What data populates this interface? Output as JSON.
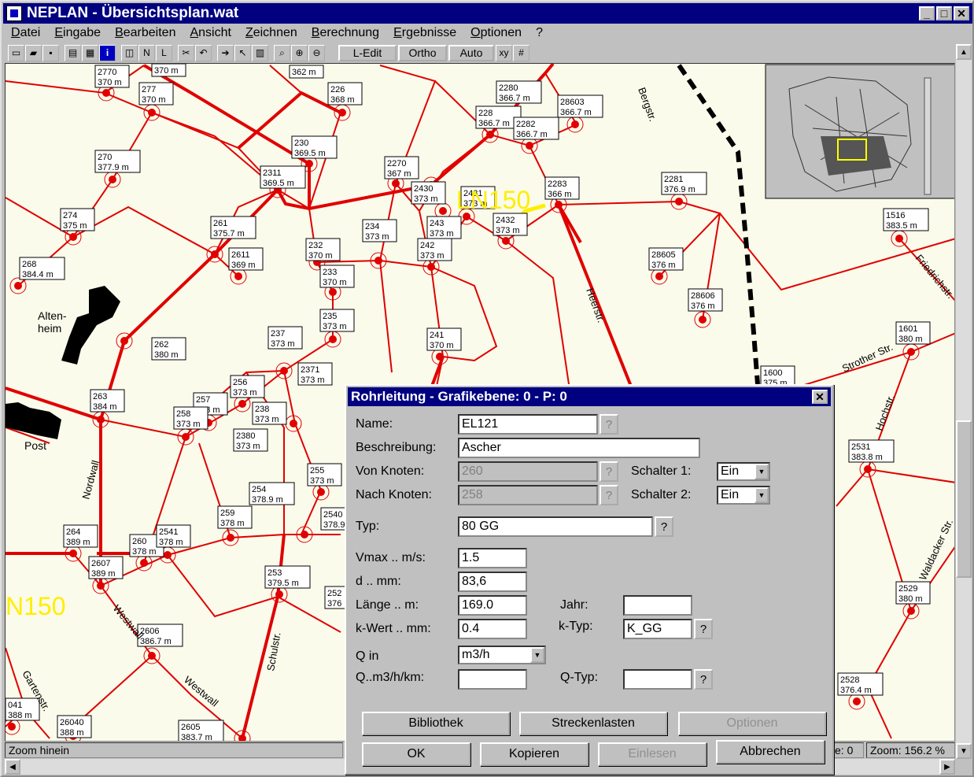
{
  "window": {
    "title": "NEPLAN  -  Übersichtsplan.wat"
  },
  "menu": [
    "Datei",
    "Eingabe",
    "Bearbeiten",
    "Ansicht",
    "Zeichnen",
    "Berechnung",
    "Ergebnisse",
    "Optionen",
    "?"
  ],
  "toolbar": {
    "ledit": "L-Edit",
    "ortho": "Ortho",
    "auto": "Auto",
    "xy": "xy"
  },
  "map": {
    "nodes": [
      {
        "id": "2770",
        "h": "370 m"
      },
      {
        "id": "370 m",
        "h": ""
      },
      {
        "id": "362 m",
        "h": ""
      },
      {
        "id": "226",
        "h": "368 m"
      },
      {
        "id": "277",
        "h": "370 m"
      },
      {
        "id": "2280",
        "h": "366.7 m"
      },
      {
        "id": "28603",
        "h": "366.7 m"
      },
      {
        "id": "228",
        "h": "366.7 m"
      },
      {
        "id": "2282",
        "h": "366.7 m"
      },
      {
        "id": "230",
        "h": "369.5 m"
      },
      {
        "id": "270",
        "h": "377.9 m"
      },
      {
        "id": "2270",
        "h": "367 m"
      },
      {
        "id": "2311",
        "h": "369.5 m"
      },
      {
        "id": "2281",
        "h": "376.9 m"
      },
      {
        "id": "2283",
        "h": "366 m"
      },
      {
        "id": "2430",
        "h": "373 m"
      },
      {
        "id": "2431",
        "h": "373 m"
      },
      {
        "id": "274",
        "h": "375 m"
      },
      {
        "id": "261",
        "h": "375.7 m"
      },
      {
        "id": "234",
        "h": "373 m"
      },
      {
        "id": "243",
        "h": "373 m"
      },
      {
        "id": "2432",
        "h": "373 m"
      },
      {
        "id": "1516",
        "h": "383.5 m"
      },
      {
        "id": "268",
        "h": "384.4 m"
      },
      {
        "id": "2611",
        "h": "369 m"
      },
      {
        "id": "232",
        "h": "370 m"
      },
      {
        "id": "242",
        "h": "373 m"
      },
      {
        "id": "28605",
        "h": "376 m"
      },
      {
        "id": "233",
        "h": "370 m"
      },
      {
        "id": "28606",
        "h": "376 m"
      },
      {
        "id": "235",
        "h": "373 m"
      },
      {
        "id": "262",
        "h": "380 m"
      },
      {
        "id": "237",
        "h": "373 m"
      },
      {
        "id": "241",
        "h": "370 m"
      },
      {
        "id": "1601",
        "h": "380 m"
      },
      {
        "id": "2371",
        "h": "373 m"
      },
      {
        "id": "1600",
        "h": "375 m"
      },
      {
        "id": "256",
        "h": "373 m"
      },
      {
        "id": "263",
        "h": "384 m"
      },
      {
        "id": "257",
        "h": "373 m"
      },
      {
        "id": "238",
        "h": "373 m"
      },
      {
        "id": "258",
        "h": "373 m"
      },
      {
        "id": "2380",
        "h": "373 m"
      },
      {
        "id": "2531",
        "h": "383.8 m"
      },
      {
        "id": "255",
        "h": "373 m"
      },
      {
        "id": "254",
        "h": "378.9 m"
      },
      {
        "id": "259",
        "h": "378 m"
      },
      {
        "id": "2540",
        "h": "378.9"
      },
      {
        "id": "264",
        "h": "389 m"
      },
      {
        "id": "260",
        "h": "378 m"
      },
      {
        "id": "2541",
        "h": "378 m"
      },
      {
        "id": "2607",
        "h": "389 m"
      },
      {
        "id": "253",
        "h": "379.5 m"
      },
      {
        "id": "252",
        "h": "376"
      },
      {
        "id": "2529",
        "h": "380 m"
      },
      {
        "id": "2606",
        "h": "386.7 m"
      },
      {
        "id": "2528",
        "h": "376.4 m"
      },
      {
        "id": "041",
        "h": "388 m"
      },
      {
        "id": "26040",
        "h": "388 m"
      },
      {
        "id": "2605",
        "h": "383.7 m"
      }
    ],
    "streets": [
      "Bergstr.",
      "Heerstr.",
      "Friedrichstr.",
      "Strother Str.",
      "Hochstr.",
      "Waldacker Str.",
      "Nordwall",
      "Westwall",
      "Schulstr.",
      "Gartenstr."
    ],
    "labels": {
      "altenheim": "Alten-\nheim",
      "post": "Post",
      "ln150": "LN150",
      "n150": "N150"
    }
  },
  "status": {
    "left": "Zoom hinein",
    "mid": "e: 0",
    "zoom": "Zoom: 156.2 %"
  },
  "dialog": {
    "title": "Rohrleitung  -  Grafikebene: 0  -  P: 0",
    "name_label": "Name:",
    "name": "EL121",
    "desc_label": "Beschreibung:",
    "desc": "Ascher",
    "from_label": "Von Knoten:",
    "from": "260",
    "to_label": "Nach Knoten:",
    "to": "258",
    "sw1_label": "Schalter 1:",
    "sw1": "Ein",
    "sw2_label": "Schalter 2:",
    "sw2": "Ein",
    "typ_label": "Typ:",
    "typ": "80 GG",
    "vmax_label": "Vmax .. m/s:",
    "vmax": "1.5",
    "d_label": "d .. mm:",
    "d": "83,6",
    "len_label": "Länge .. m:",
    "len": "169.0",
    "jahr_label": "Jahr:",
    "jahr": "",
    "k_label": "k-Wert .. mm:",
    "k": "0.4",
    "ktyp_label": "k-Typ:",
    "ktyp": "K_GG",
    "q_label": "Q in",
    "q": "m3/h",
    "qkm_label": "Q..m3/h/km:",
    "qkm": "",
    "qtyp_label": "Q-Typ:",
    "qtyp": "",
    "q_mark": "?",
    "btn_bib": "Bibliothek",
    "btn_strecken": "Streckenlasten",
    "btn_optionen": "Optionen",
    "btn_ok": "OK",
    "btn_kopieren": "Kopieren",
    "btn_einlesen": "Einlesen",
    "btn_abbrechen": "Abbrechen"
  }
}
